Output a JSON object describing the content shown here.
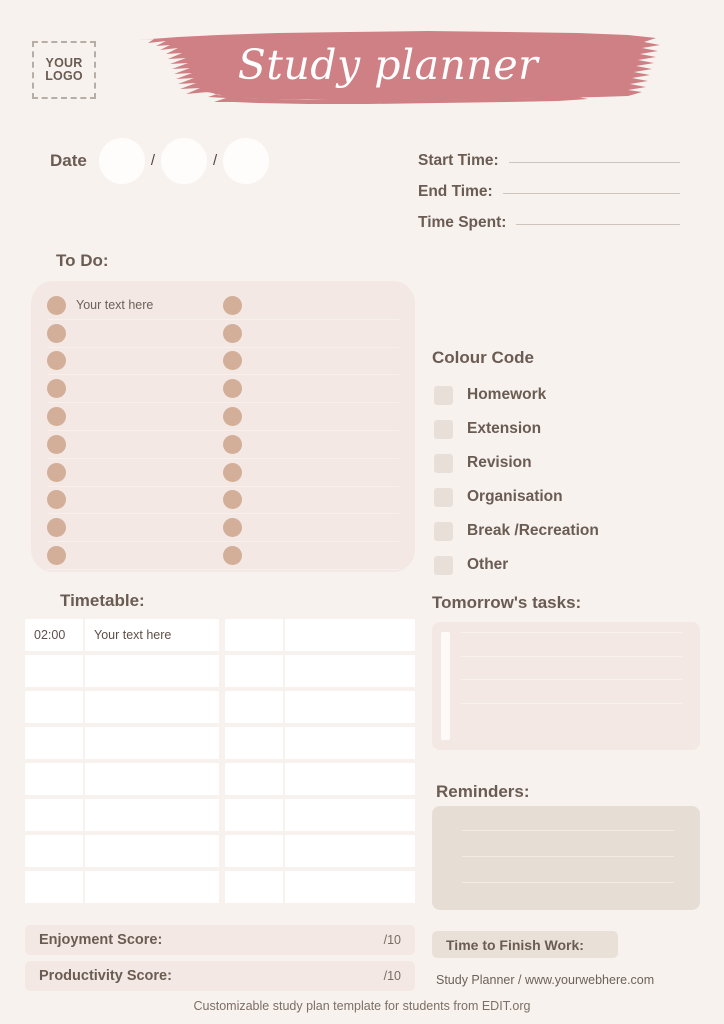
{
  "header": {
    "logo_line1": "YOUR",
    "logo_line2": "LOGO",
    "title": "Study planner",
    "brush_color": "#cf8085"
  },
  "date": {
    "label": "Date",
    "separator1": "/",
    "separator2": "/"
  },
  "time_fields": [
    {
      "label": "Start Time:"
    },
    {
      "label": "End Time:"
    },
    {
      "label": "Time Spent:"
    }
  ],
  "todo": {
    "heading": "To Do:",
    "placeholder": "Your text here",
    "rows": 10,
    "panel_color": "#f3e8e4",
    "dot_color": "#d3ae99"
  },
  "colour_code": {
    "heading": "Colour Code",
    "items": [
      {
        "label": "Homework"
      },
      {
        "label": "Extension"
      },
      {
        "label": "Revision"
      },
      {
        "label": "Organisation"
      },
      {
        "label": "Break /Recreation"
      },
      {
        "label": "Other"
      }
    ],
    "swatch_color": "#e8e0d8"
  },
  "timetable": {
    "heading": "Timetable:",
    "first_time": "02:00",
    "first_task": "Your text here",
    "rows": 8
  },
  "tomorrow": {
    "heading": "Tomorrow's tasks:",
    "panel_color": "#f3e8e4"
  },
  "reminders": {
    "heading": "Reminders:",
    "panel_color": "#e6ded4"
  },
  "scores": [
    {
      "label": "Enjoyment Score:",
      "out_of": "/10"
    },
    {
      "label": "Productivity Score:",
      "out_of": "/10"
    }
  ],
  "finish": {
    "label": "Time to Finish Work:"
  },
  "site": {
    "text": "Study Planner / www.yourwebhere.com"
  },
  "footer": {
    "text": "Customizable study plan template for students from EDIT.org"
  }
}
